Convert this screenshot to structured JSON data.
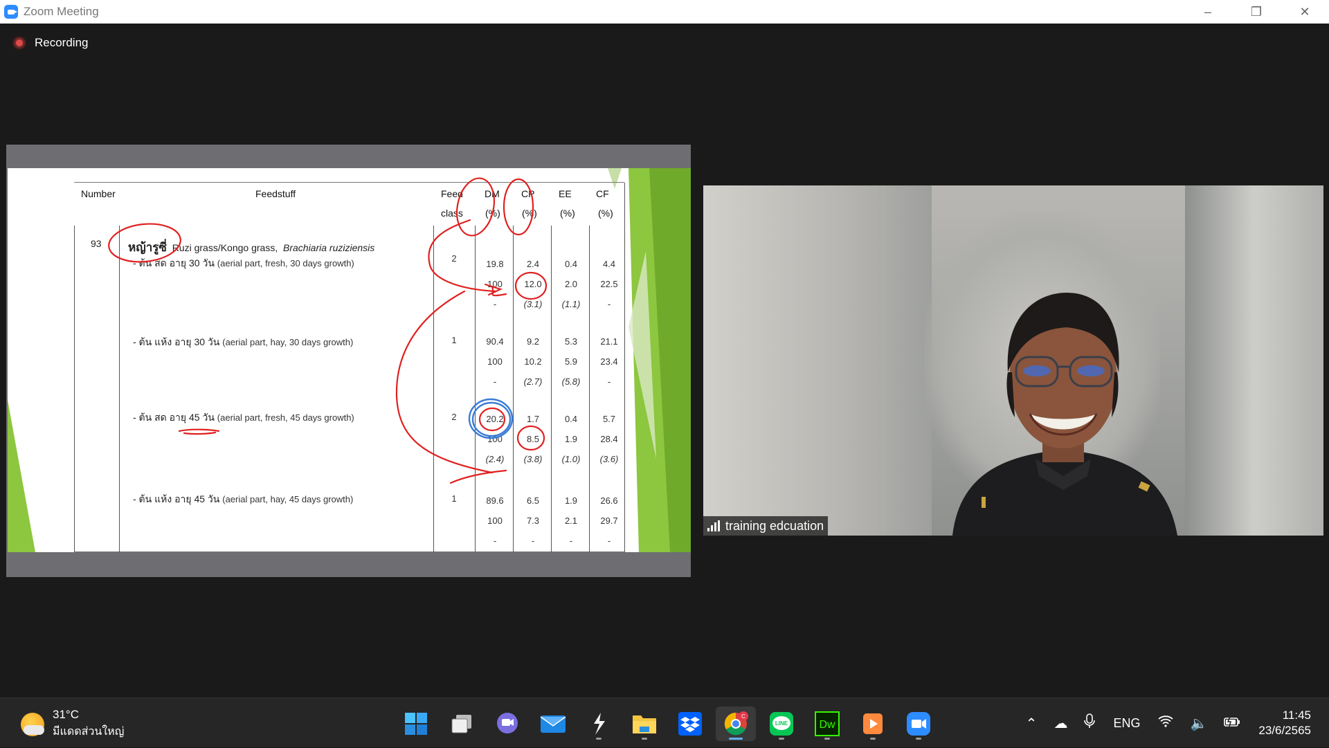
{
  "window": {
    "title": "Zoom Meeting"
  },
  "recording": {
    "label": "Recording"
  },
  "slide": {
    "headers": {
      "number": "Number",
      "feedstuff": "Feedstuff",
      "feed_class_1": "Feed",
      "feed_class_2": "class",
      "dm": "DM",
      "cp": "CP",
      "ee": "EE",
      "cf": "CF",
      "pct": "(%)"
    },
    "entry_number": "93",
    "entry_thai": "หญ้ารูซี่",
    "entry_english": "Ruzi grass/Kongo grass,",
    "entry_latin": "Brachiaria ruziziensis",
    "rows": [
      {
        "label_th": "- ต้น สด อายุ 30 วัน",
        "label_en": "(aerial part, fresh, 30 days growth)",
        "feed_class": "2",
        "dm": [
          "19.8",
          "100",
          "-"
        ],
        "cp": [
          "2.4",
          "12.0",
          "(3.1)"
        ],
        "ee": [
          "0.4",
          "2.0",
          "(1.1)"
        ],
        "cf": [
          "4.4",
          "22.5",
          "-"
        ]
      },
      {
        "label_th": "- ต้น แห้ง อายุ 30 วัน",
        "label_en": "(aerial part, hay, 30 days growth)",
        "feed_class": "1",
        "dm": [
          "90.4",
          "100",
          "-"
        ],
        "cp": [
          "9.2",
          "10.2",
          "(2.7)"
        ],
        "ee": [
          "5.3",
          "5.9",
          "(5.8)"
        ],
        "cf": [
          "21.1",
          "23.4",
          "-"
        ]
      },
      {
        "label_th": "- ต้น สด อายุ 45 วัน",
        "label_en": "(aerial part, fresh, 45 days growth)",
        "feed_class": "2",
        "dm": [
          "20.2",
          "100",
          "(2.4)"
        ],
        "cp": [
          "1.7",
          "8.5",
          "(3.8)"
        ],
        "ee": [
          "0.4",
          "1.9",
          "(1.0)"
        ],
        "cf": [
          "5.7",
          "28.4",
          "(3.6)"
        ]
      },
      {
        "label_th": "- ต้น แห้ง อายุ 45 วัน",
        "label_en": "(aerial part, hay, 45 days growth)",
        "feed_class": "1",
        "dm": [
          "89.6",
          "100",
          "-"
        ],
        "cp": [
          "6.5",
          "7.3",
          "-"
        ],
        "ee": [
          "1.9",
          "2.1",
          "-"
        ],
        "cf": [
          "26.6",
          "29.7",
          "-"
        ]
      }
    ]
  },
  "video": {
    "participant_name": "training edcuation"
  },
  "taskbar": {
    "weather_temp": "31°C",
    "weather_desc": "มีแดดส่วนใหญ่",
    "language": "ENG",
    "time": "11:45",
    "date": "23/6/2565",
    "apps": [
      "start-icon",
      "task-view-icon",
      "chat-icon",
      "mail-icon",
      "cursor-app-icon",
      "file-explorer-icon",
      "dropbox-icon",
      "chrome-icon",
      "line-icon",
      "dreamweaver-icon",
      "media-player-icon",
      "zoom-icon"
    ],
    "chrome_badge": "C",
    "line_label": "LINE",
    "dw_label": "Dw"
  },
  "colors": {
    "zoom_blue": "#2d8cff",
    "annotation_red": "#e02020",
    "annotation_blue": "#3a7bd5",
    "slide_green": "#8dc63f"
  }
}
